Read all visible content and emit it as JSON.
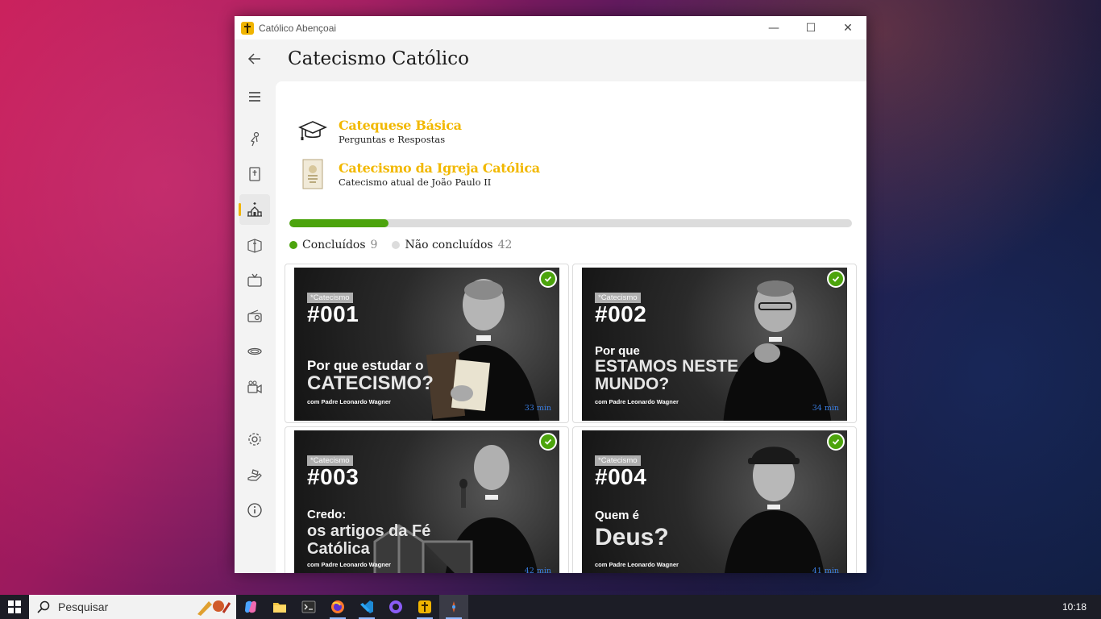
{
  "window": {
    "app_title": "Católico Abençoai",
    "minimize": "—",
    "maximize": "☐",
    "close": "✕"
  },
  "page": {
    "title": "Catecismo Católico"
  },
  "nav": {
    "items": [
      "back-icon",
      "menu-icon",
      "saint-icon",
      "bible-icon",
      "church-icon",
      "prayer-book-icon",
      "tv-icon",
      "radio-icon",
      "halo-icon",
      "video-icon",
      "settings-icon",
      "donate-icon",
      "info-icon"
    ],
    "active": "church-icon"
  },
  "links": [
    {
      "title": "Catequese Básica",
      "subtitle": "Perguntas e Respostas",
      "icon": "graduation-cap-icon"
    },
    {
      "title": "Catecismo da Igreja Católica",
      "subtitle": "Catecismo atual de João Paulo II",
      "icon": "catechism-book-icon"
    }
  ],
  "progress": {
    "completed_label": "Concluídos",
    "completed_count": "9",
    "pending_label": "Não concluídos",
    "pending_count": "42",
    "fraction": 0.176,
    "completed_color": "#4ca40d",
    "pending_color": "#dcdcdc"
  },
  "cards": [
    {
      "badge": "*Catecismo",
      "number": "#001",
      "line1": "Por que estudar o",
      "line2": "CATECISMO?",
      "credit": "com Padre Leonardo Wagner",
      "duration": "33 min",
      "done": true
    },
    {
      "badge": "*Catecismo",
      "number": "#002",
      "line1": "Por que",
      "line2": "ESTAMOS NESTE MUNDO?",
      "credit": "com Padre Leonardo Wagner",
      "duration": "34 min",
      "done": true
    },
    {
      "badge": "*Catecismo",
      "number": "#003",
      "line1": "Credo:",
      "line2": "os artigos da Fé Católica",
      "credit": "com Padre Leonardo Wagner",
      "duration": "42 min",
      "done": true
    },
    {
      "badge": "*Catecismo",
      "number": "#004",
      "line1": "Quem é",
      "line2": "Deus?",
      "credit": "com Padre Leonardo Wagner",
      "duration": "41 min",
      "done": true
    }
  ],
  "taskbar": {
    "search_placeholder": "Pesquisar",
    "time": "10:18",
    "apps": [
      "copilot-icon",
      "file-explorer-icon",
      "terminal-icon",
      "firefox-icon",
      "vscode-icon",
      "github-desktop-icon",
      "catolico-app-icon",
      "app-pinned-icon"
    ]
  },
  "colors": {
    "accent": "#f2b800",
    "success": "#4ca40d"
  }
}
